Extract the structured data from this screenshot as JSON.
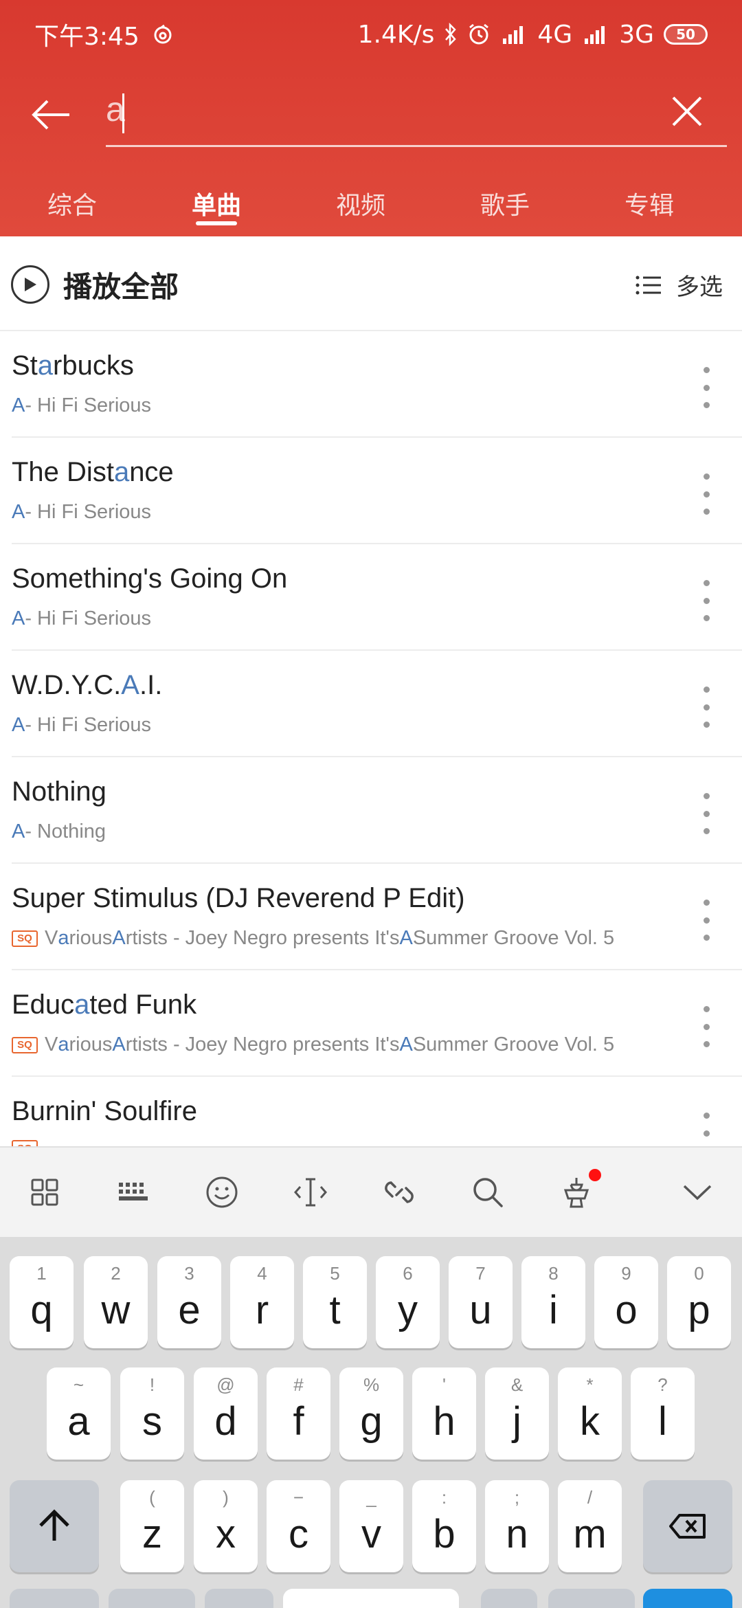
{
  "status_bar": {
    "time": "下午3:45",
    "speed": "1.4K/s",
    "network_4g": "4G",
    "network_3g": "3G",
    "battery": "50"
  },
  "search": {
    "query": "a"
  },
  "tabs": [
    {
      "label": "综合"
    },
    {
      "label": "单曲"
    },
    {
      "label": "视频"
    },
    {
      "label": "歌手"
    },
    {
      "label": "专辑"
    }
  ],
  "play_all": {
    "label": "播放全部",
    "multi_select": "多选"
  },
  "songs": [
    {
      "title_parts": [
        "St",
        "a",
        "rbucks"
      ],
      "sub_parts": [
        "A",
        " - Hi Fi Serious"
      ],
      "sq": false
    },
    {
      "title_parts": [
        "The Dist",
        "a",
        "nce"
      ],
      "sub_parts": [
        "A",
        " - Hi Fi Serious"
      ],
      "sq": false
    },
    {
      "title_parts": [
        "Something's Going On",
        "",
        ""
      ],
      "sub_parts": [
        "A",
        " - Hi Fi Serious"
      ],
      "sq": false
    },
    {
      "title_parts": [
        "W.D.Y.C.",
        "A",
        ".I."
      ],
      "sub_parts": [
        "A",
        " - Hi Fi Serious"
      ],
      "sq": false
    },
    {
      "title_parts": [
        "Nothing",
        "",
        ""
      ],
      "sub_parts": [
        "A",
        " - Nothing"
      ],
      "sq": false
    },
    {
      "title_parts": [
        "Super Stimulus (DJ Reverend P Edit)",
        "",
        ""
      ],
      "sub_v": [
        "V",
        "a",
        "rious ",
        "A",
        "rtists - Joey Negro presents It's ",
        "A",
        " Summer Groove Vol. 5"
      ],
      "sq": true
    },
    {
      "title_parts": [
        "Educ",
        "a",
        "ted Funk"
      ],
      "sub_v": [
        "V",
        "a",
        "rious ",
        "A",
        "rtists - Joey Negro presents It's ",
        "A",
        " Summer Groove Vol. 5"
      ],
      "sq": true
    },
    {
      "title_parts": [
        "Burnin' Soulfire",
        "",
        ""
      ],
      "sub_v": [
        "",
        "",
        "",
        "",
        "",
        "",
        ""
      ],
      "sq": true
    }
  ],
  "sq_badge": "SQ",
  "keyboard": {
    "row1": [
      [
        "1",
        "q"
      ],
      [
        "2",
        "w"
      ],
      [
        "3",
        "e"
      ],
      [
        "4",
        "r"
      ],
      [
        "5",
        "t"
      ],
      [
        "6",
        "y"
      ],
      [
        "7",
        "u"
      ],
      [
        "8",
        "i"
      ],
      [
        "9",
        "o"
      ],
      [
        "0",
        "p"
      ]
    ],
    "row2": [
      [
        "~",
        "a"
      ],
      [
        "!",
        "s"
      ],
      [
        "@",
        "d"
      ],
      [
        "#",
        "f"
      ],
      [
        "%",
        "g"
      ],
      [
        "'",
        "h"
      ],
      [
        "&",
        "j"
      ],
      [
        "*",
        "k"
      ],
      [
        "?",
        "l"
      ]
    ],
    "row3": [
      [
        "(",
        "z"
      ],
      [
        ")",
        "x"
      ],
      [
        "−",
        "c"
      ],
      [
        "_",
        "v"
      ],
      [
        ":",
        "b"
      ],
      [
        ";",
        "n"
      ],
      [
        "/",
        "m"
      ]
    ]
  },
  "icons": {
    "back": "arrow-left-icon",
    "clear": "close-icon",
    "play": "play-icon",
    "list": "list-icon",
    "more": "more-vertical-icon"
  },
  "colors": {
    "header": "#e04a3c",
    "highlight": "#4a7ab8",
    "sq": "#e8662f"
  }
}
